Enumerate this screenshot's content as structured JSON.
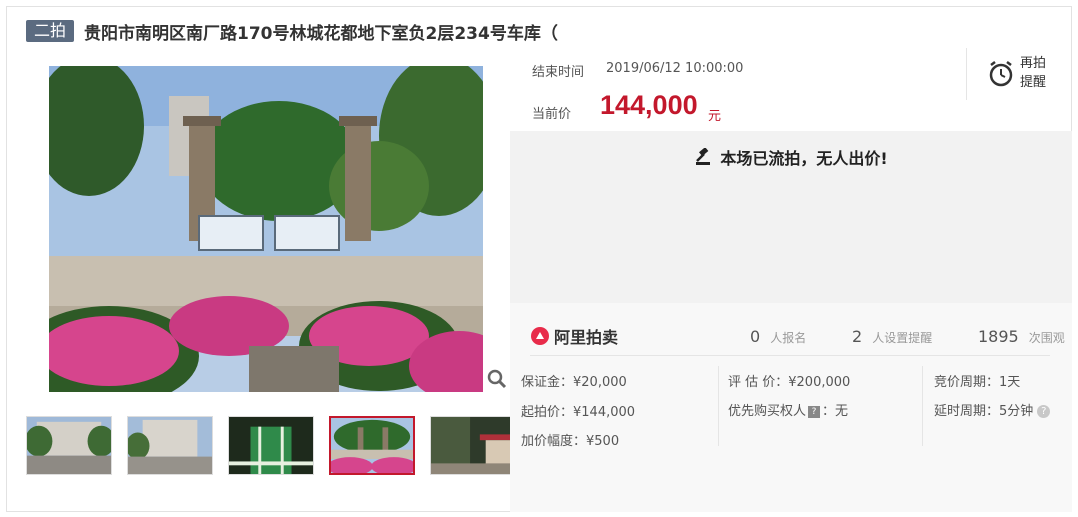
{
  "header": {
    "badge": "二拍",
    "title": "贵阳市南明区南厂路170号林城花都地下室负2层234号车库（"
  },
  "auction": {
    "end_label": "结束时间",
    "end_time": "2019/06/12 10:00:00",
    "price_label": "当前价",
    "price": "144,000",
    "price_unit": "元",
    "reminder_line1": "再拍",
    "reminder_line2": "提醒",
    "status": "本场已流拍，无人出价!"
  },
  "platform": {
    "logo_text": "阿里拍卖",
    "signups_count": "0",
    "signups_label": "人报名",
    "reminders_count": "2",
    "reminders_label": "人设置提醒",
    "views_count": "1895",
    "views_label": "次围观"
  },
  "details": {
    "deposit": "保证金：¥20,000",
    "start_price": "起拍价：¥144,000",
    "increment": "加价幅度：¥500",
    "appraisal": "评 估 价：¥200,000",
    "priority_prefix": "优先购买权人",
    "priority_tag": "?",
    "priority_value": "：无",
    "cycle": "竞价周期：1天",
    "delay": "延时周期：5分钟"
  },
  "colors": {
    "accent": "#c3182c",
    "badge_bg": "#5b6b80",
    "status_bg": "#f2f2f2"
  },
  "icons": [
    "zoom-icon",
    "alarm-clock-icon",
    "gavel-icon",
    "ali-auction-logo",
    "help-icon"
  ]
}
